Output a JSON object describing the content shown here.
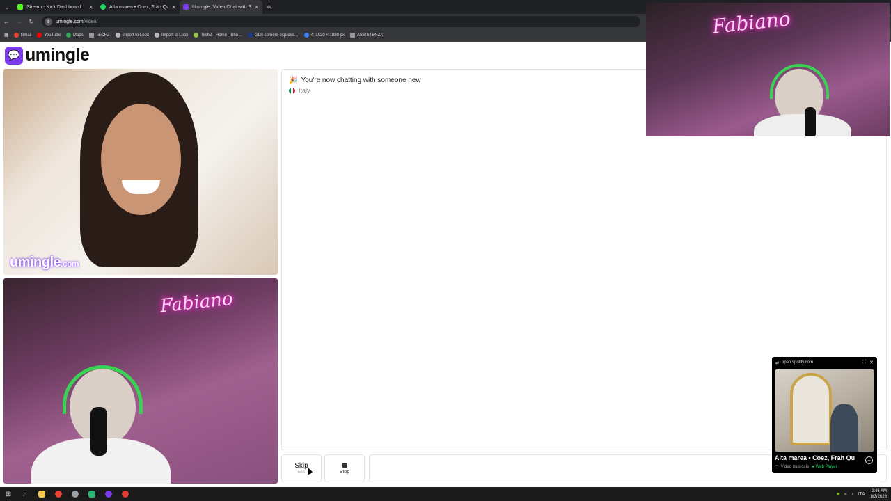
{
  "browser": {
    "tabs": [
      {
        "title": "Stream - Kick Dashboard",
        "favicon_color": "#53fc18",
        "active": false
      },
      {
        "title": "Alta marea • Coez, Frah Qu…",
        "favicon_color": "#1ed760",
        "active": false
      },
      {
        "title": "Umingle: Video Chat with S…",
        "favicon_color": "#7c3aed",
        "active": true
      }
    ],
    "new_tab": "+",
    "url_host": "umingle.com",
    "url_path": "/video/",
    "bookmarks": [
      {
        "label": "Gmail",
        "color": "#ea4335"
      },
      {
        "label": "YouTube",
        "color": "#ff0000"
      },
      {
        "label": "Maps",
        "color": "#34a853"
      },
      {
        "label": "TECHZ",
        "color": "#999999"
      },
      {
        "label": "Import to Loox",
        "color": "#bbbbbb"
      },
      {
        "label": "Import to Loox",
        "color": "#bbbbbb"
      },
      {
        "label": "TechZ - Home - Sho…",
        "color": "#95bf47"
      },
      {
        "label": "GLS corriere espress…",
        "color": "#1a3a8c"
      },
      {
        "label": "4: 1920 × 1080 px",
        "color": "#3b82f6"
      },
      {
        "label": "ASSISTENZA",
        "color": "#999999"
      }
    ]
  },
  "site": {
    "logo": "umingle",
    "watermark_brand": "umingle",
    "watermark_domain": ".com",
    "neon_sign_text": "Fabiano"
  },
  "chat": {
    "status": "You're now chatting with someone new",
    "status_icon": "party-icon",
    "country": "Italy",
    "flag_colors": [
      "#009246",
      "#ffffff",
      "#ce2b37"
    ],
    "skip_label": "Skip",
    "skip_hint": "Esc",
    "stop_label": "Stop",
    "message_value": ""
  },
  "pip": {
    "source": "open.spotify.com",
    "title": "Alta marea • Coez, Frah Qu",
    "subtitle": "Video musicale",
    "player": "Web Player"
  },
  "taskbar": {
    "apps": [
      {
        "name": "start",
        "color": "#ffffff"
      },
      {
        "name": "search",
        "color": "#ffffff"
      },
      {
        "name": "explorer",
        "color": "#f2c94c"
      },
      {
        "name": "chrome",
        "color": "#ea4335"
      },
      {
        "name": "app",
        "color": "#9aa0a6"
      },
      {
        "name": "terminal",
        "color": "#2bb673"
      },
      {
        "name": "obs",
        "color": "#7c3aed"
      },
      {
        "name": "recorder",
        "color": "#e53935"
      }
    ],
    "time": "2:46 AM",
    "date": "8/3/2026",
    "lang": "ITA"
  }
}
